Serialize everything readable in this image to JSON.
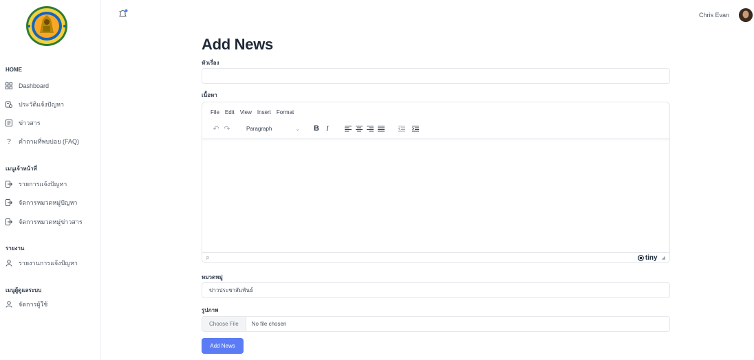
{
  "sidebar": {
    "sections": [
      {
        "title": "HOME",
        "items": [
          {
            "label": "Dashboard",
            "icon": "grid-icon"
          },
          {
            "label": "ประวัติแจ้งปัญหา",
            "icon": "history-icon"
          },
          {
            "label": "ข่าวสาร",
            "icon": "news-icon"
          },
          {
            "label": "คำถามที่พบบ่อย (FAQ)",
            "icon": "question-icon"
          }
        ]
      },
      {
        "title": "เมนูเจ้าหน้าที่",
        "items": [
          {
            "label": "รายการแจ้งปัญหา",
            "icon": "login-icon"
          },
          {
            "label": "จัดการหมวดหมู่ปัญหา",
            "icon": "login-icon"
          },
          {
            "label": "จัดการหมวดหมู่ข่าวสาร",
            "icon": "login-icon"
          }
        ]
      },
      {
        "title": "รายงาน",
        "items": [
          {
            "label": "รายงานการแจ้งปัญหา",
            "icon": "user-icon"
          }
        ]
      },
      {
        "title": "เมนูผู้ดูแลระบบ",
        "items": [
          {
            "label": "จัดการผู้ใช้",
            "icon": "user-icon"
          }
        ]
      }
    ]
  },
  "topbar": {
    "user_name": "Chris Evan"
  },
  "form": {
    "title": "Add News",
    "subject_label": "หัวเรื่อง",
    "subject_value": "",
    "content_label": "เนื้อหา",
    "category_label": "หมวดหมู่",
    "category_value": "ข่าวประชาสัมพันธ์",
    "image_label": "รูปภาพ",
    "file_button": "Choose File",
    "file_status": "No file chosen",
    "submit_label": "Add News"
  },
  "editor": {
    "menu": [
      "File",
      "Edit",
      "View",
      "Insert",
      "Format"
    ],
    "block_format": "Paragraph",
    "path": "p",
    "brand": "tiny"
  },
  "colors": {
    "accent": "#5b7cf5",
    "border": "#e5e7eb"
  }
}
